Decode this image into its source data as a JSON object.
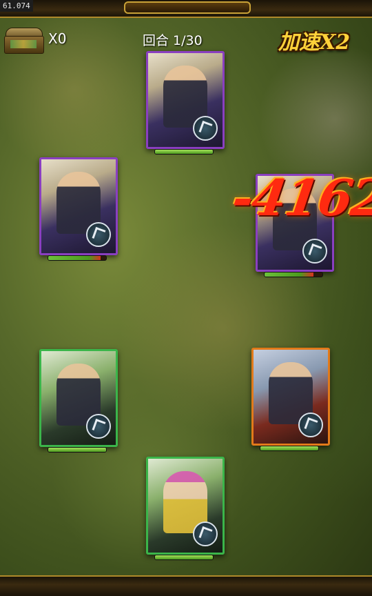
{
  "debug": {
    "fps": "61.074"
  },
  "hud": {
    "chest_count": "X0",
    "round": "回合 1/30",
    "speed": "加速X2"
  },
  "battle": {
    "damage_popup": "-4162",
    "units": [
      {
        "id": "top-purple",
        "rarity": "purple",
        "hp": 1.0
      },
      {
        "id": "left-purple",
        "rarity": "purple",
        "hp": 0.9
      },
      {
        "id": "right-purple",
        "rarity": "purple",
        "hp": 0.85
      },
      {
        "id": "left-green",
        "rarity": "green",
        "hp": 1.0
      },
      {
        "id": "right-orange",
        "rarity": "orange",
        "hp": 1.0
      },
      {
        "id": "bottom-green",
        "rarity": "green",
        "hp": 1.0
      }
    ]
  }
}
